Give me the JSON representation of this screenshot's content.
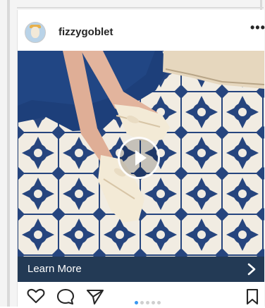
{
  "post": {
    "username": "fizzygoblet",
    "more_label": "•••"
  },
  "media": {
    "type": "video",
    "play_icon": "play-icon"
  },
  "cta": {
    "label": "Learn More",
    "arrow": "chevron-right-icon"
  },
  "actions": {
    "icons": [
      "heart-icon",
      "comment-icon",
      "share-icon",
      "bookmark-icon"
    ]
  },
  "carousel": {
    "count": 5,
    "active_index": 0
  },
  "colors": {
    "cta_bar": "#233a55",
    "active_dot": "#3897f0",
    "tile_blue": "#1f3f77",
    "tile_cream": "#f1ece2",
    "skirt": "#1d3f7a"
  }
}
